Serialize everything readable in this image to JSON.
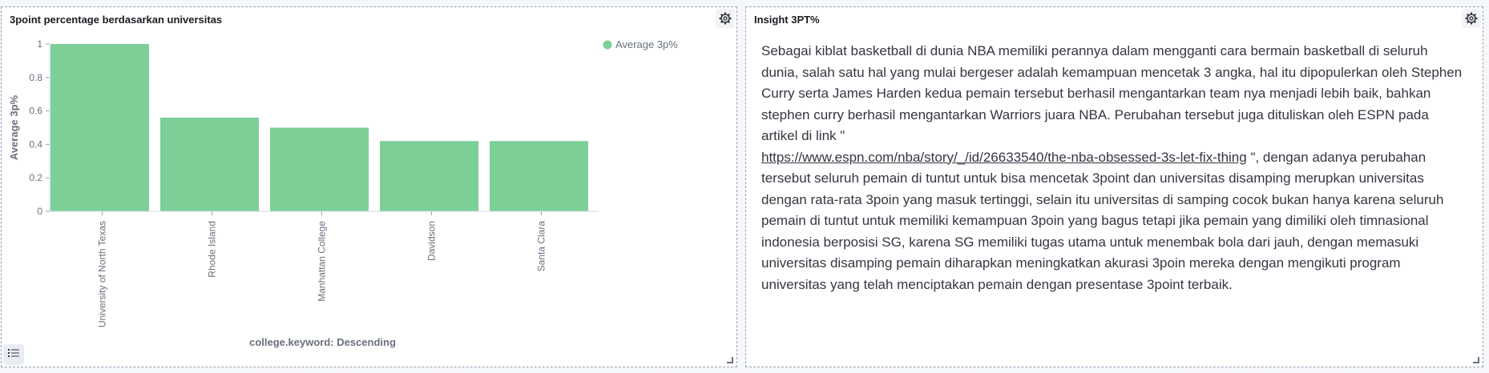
{
  "left_panel": {
    "title": "3point percentage berdasarkan universitas",
    "gear_icon": "gear-icon",
    "list_icon": "list-icon"
  },
  "right_panel": {
    "title": "Insight 3PT%",
    "gear_icon": "gear-icon",
    "text_before_link": "Sebagai kiblat basketball di dunia NBA memiliki perannya dalam mengganti cara bermain basketball di seluruh dunia, salah satu hal yang mulai bergeser adalah kemampuan mencetak 3 angka, hal itu dipopulerkan oleh Stephen Curry serta James Harden kedua pemain tersebut berhasil mengantarkan team nya menjadi lebih baik, bahkan stephen curry berhasil mengantarkan Warriors juara NBA. Perubahan tersebut juga dituliskan oleh ESPN pada artikel di link \"",
    "link": "https://www.espn.com/nba/story/_/id/26633540/the-nba-obsessed-3s-let-fix-thing",
    "text_after_link": " \", dengan adanya perubahan tersebut seluruh pemain di tuntut untuk bisa mencetak 3point dan universitas disamping merupkan universitas dengan rata-rata 3poin yang masuk tertinggi, selain itu universitas di samping cocok bukan hanya karena seluruh pemain di tuntut untuk memiliki kemampuan 3poin yang bagus tetapi jika pemain yang dimiliki oleh timnasional indonesia berposisi SG, karena SG memiliki tugas utama untuk menembak bola dari jauh, dengan memasuki universitas disamping pemain diharapkan meningkatkan akurasi 3poin mereka dengan mengikuti program universitas yang telah menciptakan pemain dengan presentase 3point terbaik."
  },
  "chart_data": {
    "type": "bar",
    "categories": [
      "University of North Texas",
      "Rhode Island",
      "Manhattan College",
      "Davidson",
      "Santa Clara"
    ],
    "series": [
      {
        "name": "Average 3p%",
        "values": [
          1.0,
          0.56,
          0.5,
          0.42,
          0.42
        ],
        "color": "#7dcf98"
      }
    ],
    "xlabel": "college.keyword: Descending",
    "ylabel": "Average 3p%",
    "ylim": [
      0,
      1
    ],
    "yticks": [
      "0",
      "0.2",
      "0.4",
      "0.6",
      "0.8",
      "1"
    ],
    "legend_position": "top-right",
    "grid": false
  }
}
